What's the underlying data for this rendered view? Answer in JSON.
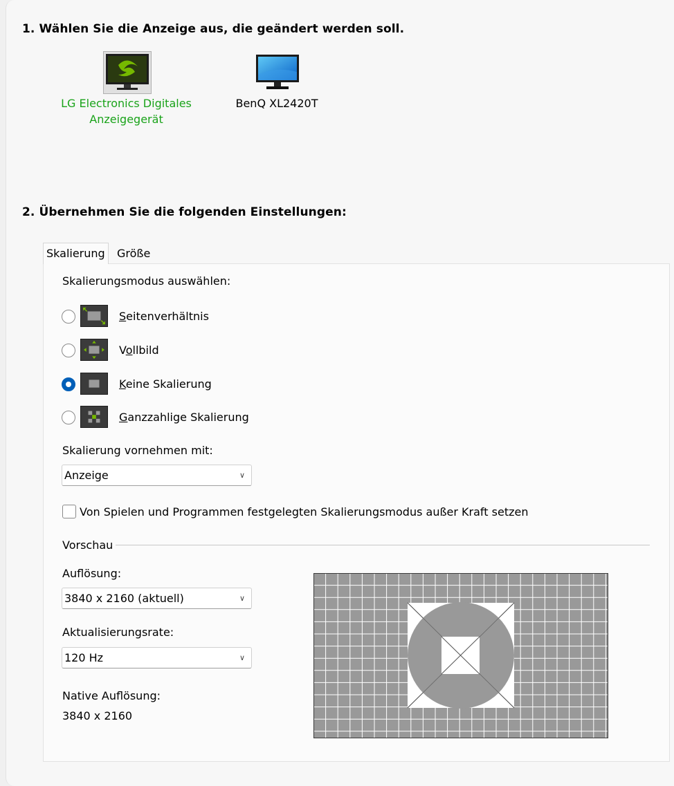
{
  "step1": {
    "heading": "1. Wählen Sie die Anzeige aus, die geändert werden soll."
  },
  "displays": [
    {
      "line1": "LG Electronics Digitales",
      "line2": "Anzeigegerät",
      "selected": true,
      "icon": "nvidia-monitor-icon"
    },
    {
      "line1": "BenQ XL2420T",
      "line2": "",
      "selected": false,
      "icon": "monitor-icon"
    }
  ],
  "step2": {
    "heading": "2. Übernehmen Sie die folgenden Einstellungen:"
  },
  "tabs": [
    {
      "label": "Skalierung",
      "active": true
    },
    {
      "label": "Größe",
      "active": false
    }
  ],
  "scaling": {
    "mode_label": "Skalierungsmodus auswählen:",
    "modes": [
      {
        "key": "S",
        "rest": "eitenverhältnis",
        "checked": false,
        "icon": "aspect-ratio-icon"
      },
      {
        "key": "o",
        "pre": "V",
        "rest": "llbild",
        "checked": false,
        "icon": "fullscreen-icon"
      },
      {
        "key": "K",
        "rest": "eine Skalierung",
        "checked": true,
        "icon": "no-scaling-icon"
      },
      {
        "key": "G",
        "rest": "anzzahlige Skalierung",
        "checked": false,
        "icon": "integer-scaling-icon"
      }
    ],
    "perform_label": "Skalierung vornehmen mit:",
    "perform_value": "Anzeige",
    "override_label": "Von Spielen und Programmen festgelegten Skalierungsmodus außer Kraft setzen",
    "override_checked": false
  },
  "preview": {
    "group_label": "Vorschau",
    "resolution_label": "Auflösung:",
    "resolution_value": "3840 x 2160 (aktuell)",
    "refresh_label": "Aktualisierungsrate:",
    "refresh_value": "120 Hz",
    "native_label": "Native Auflösung:",
    "native_value": "3840 x 2160"
  },
  "colors": {
    "accent_green": "#1aa31a",
    "radio_blue": "#005fb8",
    "nvidia_green": "#76b900"
  }
}
